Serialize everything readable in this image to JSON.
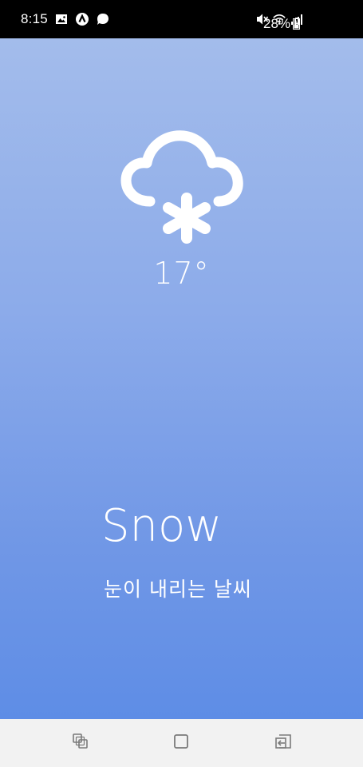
{
  "status_bar": {
    "time": "8:15",
    "battery": "28%",
    "left_icons": [
      "image-icon",
      "a-badge-icon",
      "chat-icon"
    ],
    "right_icons": [
      "mute-icon",
      "wifi-icon",
      "signal-icon",
      "battery-icon"
    ]
  },
  "weather": {
    "icon": "cloud-snow-icon",
    "temperature": "17°",
    "condition": "Snow",
    "description": "눈이 내리는 날씨"
  },
  "nav_bar": {
    "icons": [
      "recent-apps-icon",
      "home-icon",
      "back-icon"
    ]
  },
  "colors": {
    "gradient_top": "#a3bceb",
    "gradient_bottom": "#5e8de6",
    "nav_bg": "#f2f2f2"
  }
}
